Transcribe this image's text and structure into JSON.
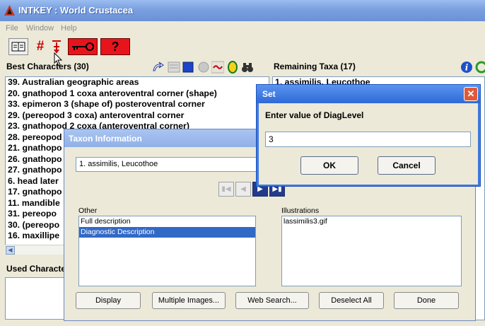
{
  "window": {
    "title": "INTKEY : World Crustacea"
  },
  "menu": {
    "items": [
      "File",
      "Window",
      "Help"
    ]
  },
  "toolbar": {
    "hash_label": "#",
    "help_label": "?"
  },
  "best": {
    "header": "Best Characters (30)",
    "rows": [
      "39. Australian geographic areas",
      "20. gnathopod 1 coxa anteroventral corner (shape)",
      "33. epimeron 3 (shape of) posteroventral corner",
      "29. (pereopod 3 coxa) anteroventral corner",
      "23. gnathopod 2 coxa (anteroventral corner)",
      "28. pereopod",
      "21. gnathopo",
      "26. gnathopo",
      "27. gnathopo",
      "6. head later",
      "17. gnathopo",
      "11. mandible",
      "31. pereopo",
      "30. (pereopo",
      "16. maxillipe"
    ]
  },
  "used": {
    "header": "Used Characters"
  },
  "remaining": {
    "header": "Remaining Taxa (17)",
    "rows": [
      "1. assimilis, Leucothoe"
    ]
  },
  "taxon_dialog": {
    "title": "Taxon Information",
    "selected_taxon": "1. assimilis, Leucothoe",
    "other_label": "Other",
    "other_items": [
      "Full description",
      "Diagnostic Description"
    ],
    "illustrations_label": "Illustrations",
    "illustration_items": [
      "lassimilis3.gif"
    ],
    "buttons": {
      "display": "Display",
      "multiple_images": "Multiple Images...",
      "web_search": "Web Search...",
      "deselect_all": "Deselect All",
      "done": "Done"
    }
  },
  "set_dialog": {
    "title": "Set",
    "prompt": "Enter value of DiagLevel",
    "value": "3",
    "ok": "OK",
    "cancel": "Cancel",
    "close_glyph": "✕"
  }
}
